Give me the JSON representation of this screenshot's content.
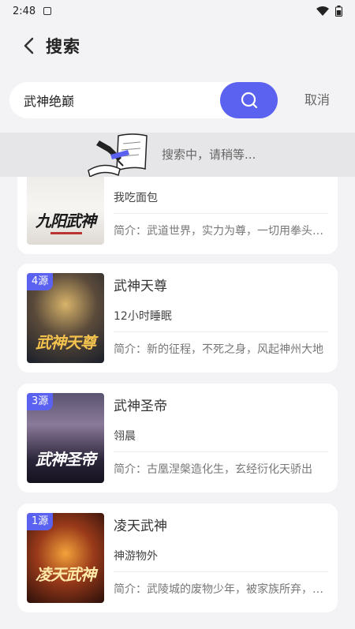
{
  "status_bar": {
    "time": "2:48"
  },
  "header": {
    "title": "搜索"
  },
  "search": {
    "value": "武神绝巅",
    "cancel_label": "取消"
  },
  "loading": {
    "text": "搜索中，请稍等..."
  },
  "books": [
    {
      "title": "",
      "author": "我吃面包",
      "intro": "简介：武道世界，实力为尊，一切用拳头说话",
      "source_badge": "",
      "cover_text": "九阳武神"
    },
    {
      "title": "武神天尊",
      "author": "12小时睡眠",
      "intro": "简介：新的征程，不死之身，风起神州大地",
      "source_badge": "4源",
      "cover_text": "武神天尊"
    },
    {
      "title": "武神圣帝",
      "author": "翎晨",
      "intro": "简介：古凰涅槃造化生，玄经衍化天骄出",
      "source_badge": "3源",
      "cover_text": "武神圣帝"
    },
    {
      "title": "凌天武神",
      "author": "神游物外",
      "intro": "简介：武陵城的废物少年，被家族所弃，意外获得",
      "source_badge": "1源",
      "cover_text": "凌天武神"
    }
  ],
  "colors": {
    "accent": "#5b62f0",
    "background": "#f3f3f5",
    "loading_bg": "#e6e6e8"
  }
}
